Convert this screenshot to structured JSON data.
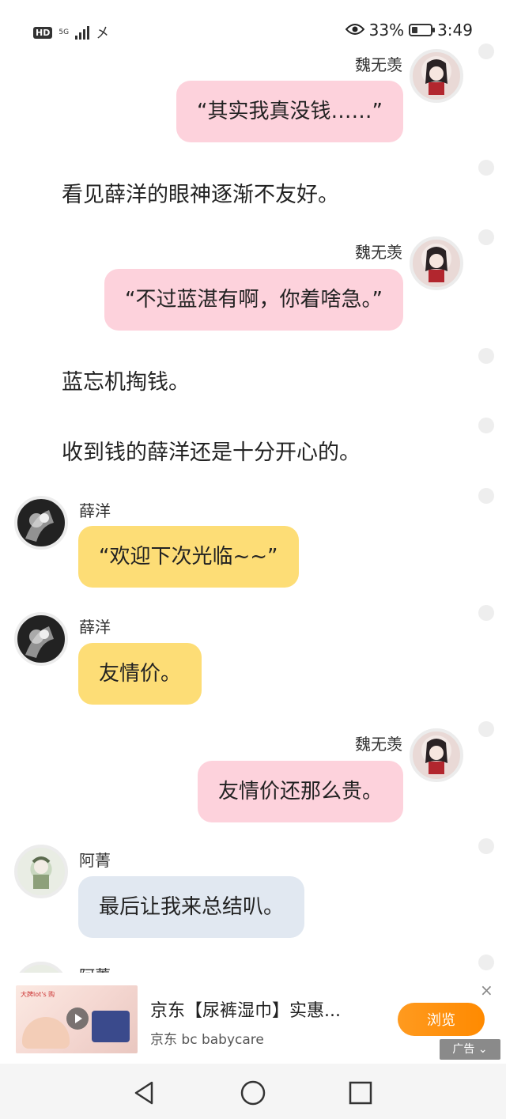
{
  "status_bar": {
    "hd": "HD",
    "network": "5G",
    "ime": "㐅",
    "battery_percent": "33%",
    "battery_level": 0.33,
    "time": "3:49"
  },
  "messages": [
    {
      "speaker": "魏无羡",
      "text": "“其实我真没钱……”"
    },
    {
      "narration": "看见薛洋的眼神逐渐不友好。"
    },
    {
      "speaker": "魏无羡",
      "text": "“不过蓝湛有啊，你着啥急。”"
    },
    {
      "narration": "蓝忘机掏钱。"
    },
    {
      "narration": "收到钱的薛洋还是十分开心的。"
    },
    {
      "speaker": "薛洋",
      "text": "“欢迎下次光临~~”"
    },
    {
      "speaker": "薛洋",
      "text": "友情价。"
    },
    {
      "speaker": "魏无羡",
      "text": "友情价还那么贵。"
    },
    {
      "speaker": "阿菁",
      "text": "最后让我来总结叭。"
    },
    {
      "speaker": "阿菁"
    }
  ],
  "ad": {
    "thumb_text": "大牌lot's 购",
    "title": "京东【尿裤湿巾】实惠...",
    "subtitle": "京东 bc babycare",
    "button": "浏览",
    "tag": "广告",
    "close": "×"
  },
  "colors": {
    "bubble_wei": "#fdd2dc",
    "bubble_xue": "#fddd76",
    "bubble_a": "#e1e8f1",
    "ad_button": "#ff9a1f"
  }
}
